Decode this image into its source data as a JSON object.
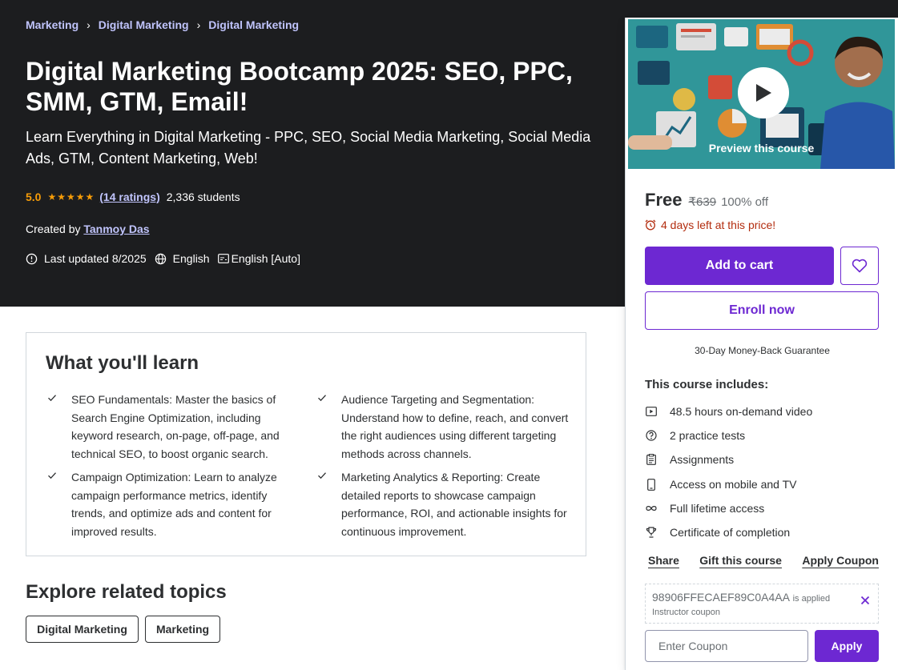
{
  "breadcrumb": [
    "Marketing",
    "Digital Marketing",
    "Digital Marketing"
  ],
  "course": {
    "title": "Digital Marketing Bootcamp 2025: SEO, PPC, SMM, GTM, Email!",
    "subtitle": "Learn Everything in Digital Marketing - PPC, SEO, Social Media Marketing, Social Media Ads, GTM, Content Marketing, Web!",
    "rating": "5.0",
    "stars": "★★★★★",
    "ratings_count": "(14 ratings)",
    "students": "2,336 students",
    "created_by_label": "Created by",
    "author": "Tanmoy Das",
    "last_updated": "Last updated 8/2025",
    "language": "English",
    "captions": "English [Auto]"
  },
  "learn": {
    "title": "What you'll learn",
    "items": [
      "SEO Fundamentals: Master the basics of Search Engine Optimization, including keyword research, on-page, off-page, and technical SEO, to boost organic search.",
      "Audience Targeting and Segmentation: Understand how to define, reach, and convert the right audiences using different targeting methods across channels.",
      "Campaign Optimization: Learn to analyze campaign performance metrics, identify trends, and optimize ads and content for improved results.",
      "Marketing Analytics & Reporting: Create detailed reports to showcase campaign performance, ROI, and actionable insights for continuous improvement."
    ]
  },
  "explore": {
    "title": "Explore related topics",
    "topics": [
      "Digital Marketing",
      "Marketing"
    ]
  },
  "sidebar": {
    "preview_label": "Preview this course",
    "price": "Free",
    "old_price": "₹639",
    "discount": "100% off",
    "timer": "4 days left at this price!",
    "add_to_cart": "Add to cart",
    "enroll": "Enroll now",
    "guarantee": "30-Day Money-Back Guarantee",
    "includes_title": "This course includes:",
    "includes": [
      {
        "icon": "video-icon",
        "label": "48.5 hours on-demand video"
      },
      {
        "icon": "question-icon",
        "label": "2 practice tests"
      },
      {
        "icon": "assignment-icon",
        "label": "Assignments"
      },
      {
        "icon": "mobile-icon",
        "label": "Access on mobile and TV"
      },
      {
        "icon": "infinity-icon",
        "label": "Full lifetime access"
      },
      {
        "icon": "trophy-icon",
        "label": "Certificate of completion"
      }
    ],
    "share": "Share",
    "gift": "Gift this course",
    "apply_coupon": "Apply Coupon",
    "coupon_code": "98906FFECAEF89C0A4AA",
    "coupon_applied": "is applied",
    "coupon_kind": "Instructor coupon",
    "coupon_placeholder": "Enter Coupon",
    "apply": "Apply"
  },
  "colors": {
    "hero_bg": "#1c1d1f",
    "accent": "#6d28d2",
    "link": "#c0c4fc",
    "star": "#f69c08",
    "alert": "#b32d0f"
  }
}
